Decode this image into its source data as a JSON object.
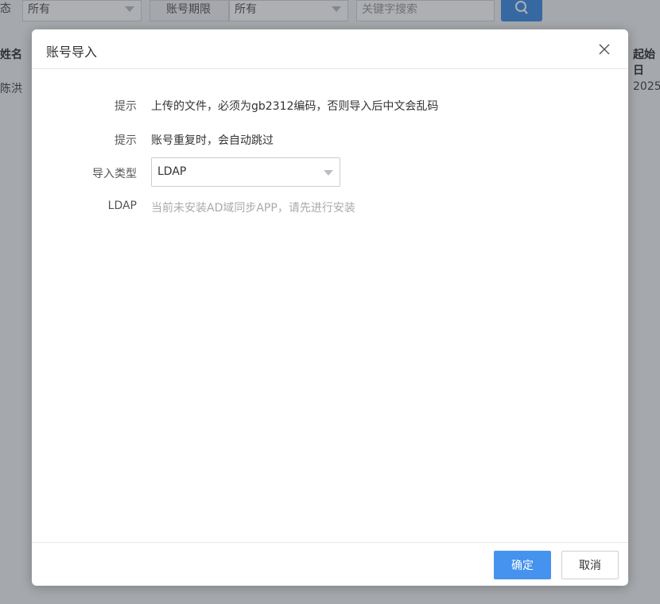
{
  "background": {
    "filters": [
      {
        "label": "态",
        "value": "所有"
      },
      {
        "label": "账号期限",
        "value": "所有"
      }
    ],
    "search_placeholder": "关键字搜索",
    "table": {
      "headers": [
        "姓名",
        "起始日"
      ],
      "first_row": [
        "陈洪",
        "2025"
      ]
    }
  },
  "modal": {
    "title": "账号导入",
    "rows": [
      {
        "label": "提示",
        "value": "上传的文件，必须为gb2312编码，否则导入后中文会乱码"
      },
      {
        "label": "提示",
        "value": "账号重复时，会自动跳过"
      },
      {
        "label": "导入类型",
        "value": "LDAP"
      },
      {
        "label": "LDAP",
        "value": "当前未安装AD域同步APP，请先进行安装"
      }
    ],
    "confirm_label": "确定",
    "cancel_label": "取消"
  },
  "colors": {
    "primary": "#4593ef",
    "search_button": "#3f8ee6"
  }
}
